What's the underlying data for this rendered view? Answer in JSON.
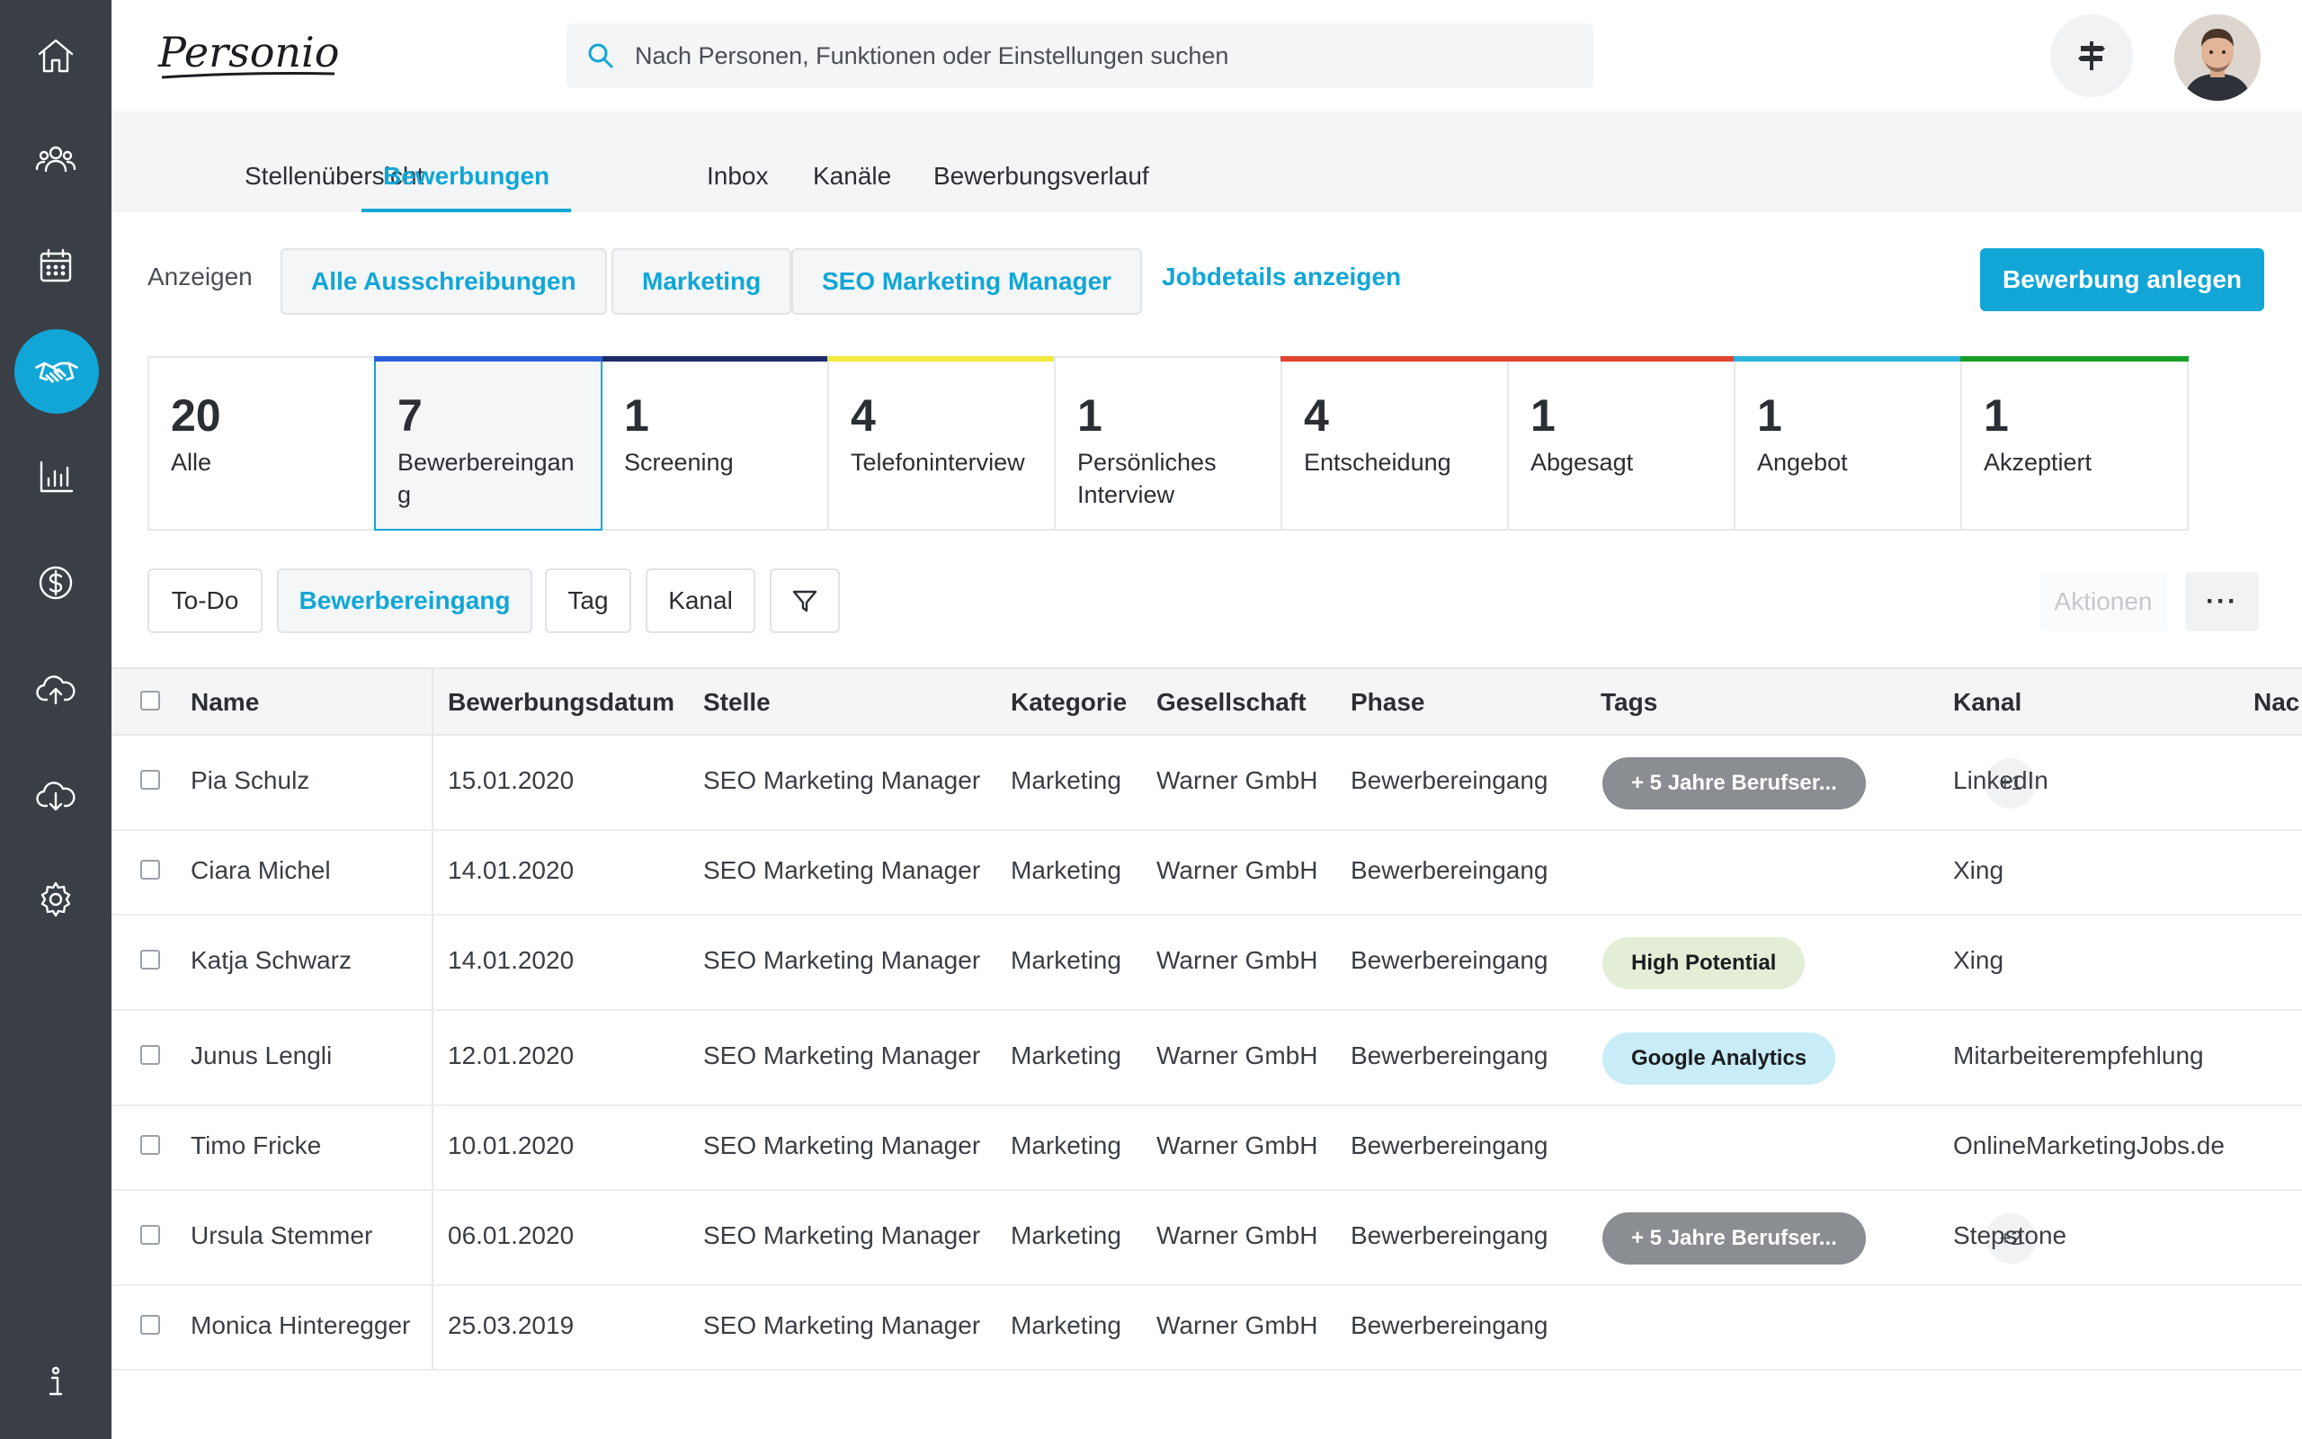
{
  "app": {
    "logo_text": "Personio"
  },
  "search": {
    "placeholder": "Nach Personen, Funktionen oder Einstellungen suchen"
  },
  "sidebar": {
    "items": [
      {
        "icon": "home-icon"
      },
      {
        "icon": "people-icon"
      },
      {
        "icon": "calendar-icon"
      },
      {
        "icon": "handshake-icon",
        "active": true
      },
      {
        "icon": "chart-icon"
      },
      {
        "icon": "dollar-icon"
      },
      {
        "icon": "cloud-upload-icon"
      },
      {
        "icon": "cloud-download-icon"
      },
      {
        "icon": "gear-icon"
      },
      {
        "icon": "info-icon"
      }
    ]
  },
  "tabs": [
    {
      "label": "Stellenübersicht"
    },
    {
      "label": "Bewerbungen",
      "active": true
    },
    {
      "label": "Inbox"
    },
    {
      "label": "Kanäle"
    },
    {
      "label": "Bewerbungsverlauf"
    }
  ],
  "filters": {
    "show_label": "Anzeigen",
    "chips": [
      "Alle Ausschreibungen",
      "Marketing",
      "SEO Marketing Manager"
    ],
    "job_details_link": "Jobdetails anzeigen",
    "create_button": "Bewerbung anlegen"
  },
  "phases": [
    {
      "count": "20",
      "label": "Alle",
      "color": ""
    },
    {
      "count": "7",
      "label": "Bewerbereingang",
      "color": "#2b5fd9",
      "selected": true
    },
    {
      "count": "1",
      "label": "Screening",
      "color": "#1f2a6b"
    },
    {
      "count": "4",
      "label": "Telefoninterview",
      "color": "#f2e93b"
    },
    {
      "count": "1",
      "label": "Persönliches Interview",
      "color": ""
    },
    {
      "count": "4",
      "label": "Entscheidung",
      "color": "#e0432f"
    },
    {
      "count": "1",
      "label": "Abgesagt",
      "color": "#e0432f"
    },
    {
      "count": "1",
      "label": "Angebot",
      "color": "#2bb5dd"
    },
    {
      "count": "1",
      "label": "Akzeptiert",
      "color": "#1a9e2a"
    }
  ],
  "list_filters": {
    "todo": "To-Do",
    "phase": "Bewerbereingang",
    "tag": "Tag",
    "channel": "Kanal",
    "actions": "Aktionen",
    "more": "···"
  },
  "table": {
    "columns": [
      "Name",
      "Bewerbungsdatum",
      "Stelle",
      "Kategorie",
      "Gesellschaft",
      "Phase",
      "Tags",
      "Kanal",
      "Nac"
    ],
    "rows": [
      {
        "name": "Pia Schulz",
        "date": "15.01.2020",
        "position": "SEO Marketing Manager",
        "category": "Marketing",
        "company": "Warner GmbH",
        "phase": "Bewerbereingang",
        "tag": "+ 5 Jahre Berufser...",
        "tag_style": "gray",
        "tag_more": "+1",
        "channel": "LinkedIn"
      },
      {
        "name": "Ciara Michel",
        "date": "14.01.2020",
        "position": "SEO Marketing Manager",
        "category": "Marketing",
        "company": "Warner GmbH",
        "phase": "Bewerbereingang",
        "tag": "",
        "tag_style": "",
        "tag_more": "",
        "channel": "Xing"
      },
      {
        "name": "Katja Schwarz",
        "date": "14.01.2020",
        "position": "SEO Marketing Manager",
        "category": "Marketing",
        "company": "Warner GmbH",
        "phase": "Bewerbereingang",
        "tag": "High Potential",
        "tag_style": "green",
        "tag_more": "",
        "channel": "Xing"
      },
      {
        "name": "Junus Lengli",
        "date": "12.01.2020",
        "position": "SEO Marketing Manager",
        "category": "Marketing",
        "company": "Warner GmbH",
        "phase": "Bewerbereingang",
        "tag": "Google Analytics",
        "tag_style": "blue",
        "tag_more": "",
        "channel": "Mitarbeiterempfehlung"
      },
      {
        "name": "Timo Fricke",
        "date": "10.01.2020",
        "position": "SEO Marketing Manager",
        "category": "Marketing",
        "company": "Warner GmbH",
        "phase": "Bewerbereingang",
        "tag": "",
        "tag_style": "",
        "tag_more": "",
        "channel": "OnlineMarketingJobs.de"
      },
      {
        "name": "Ursula Stemmer",
        "date": "06.01.2020",
        "position": "SEO Marketing Manager",
        "category": "Marketing",
        "company": "Warner GmbH",
        "phase": "Bewerbereingang",
        "tag": "+ 5 Jahre Berufser...",
        "tag_style": "gray",
        "tag_more": "+2",
        "channel": "Stepstone"
      },
      {
        "name": "Monica Hinteregger",
        "date": "25.03.2019",
        "position": "SEO Marketing Manager",
        "category": "Marketing",
        "company": "Warner GmbH",
        "phase": "Bewerbereingang",
        "tag": "",
        "tag_style": "",
        "tag_more": "",
        "channel": ""
      }
    ]
  },
  "colors": {
    "accent": "#11a6d6",
    "sidebar": "#3a3f46",
    "tag_gray_bg": "#8a8d91",
    "tag_green_bg": "#e4eed6",
    "tag_blue_bg": "#c8ecf8"
  }
}
